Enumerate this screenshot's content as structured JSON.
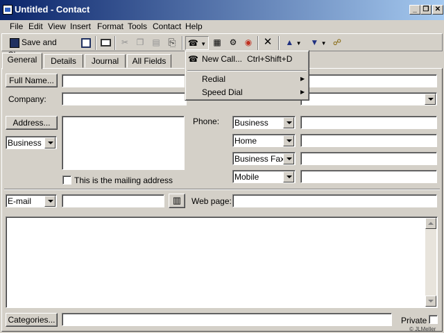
{
  "window": {
    "title": "Untitled - Contact",
    "buttons": {
      "minimize": "_",
      "maximize": "❐",
      "close": "✕"
    }
  },
  "menu": [
    {
      "label": "File",
      "key": "F"
    },
    {
      "label": "Edit",
      "key": "E"
    },
    {
      "label": "View",
      "key": "V"
    },
    {
      "label": "Insert",
      "key": "I"
    },
    {
      "label": "Format",
      "key": "o"
    },
    {
      "label": "Tools",
      "key": "T"
    },
    {
      "label": "Contact",
      "key": "C"
    },
    {
      "label": "Help",
      "key": "H"
    }
  ],
  "toolbar": {
    "save_close": "Save and Close",
    "icons": [
      "save-icon",
      "print-icon",
      "cut-icon",
      "copy-icon",
      "paste-icon",
      "attach-icon",
      "dial-phone-icon",
      "new-meeting-icon",
      "new-task-icon",
      "journal-icon",
      "delete-icon",
      "previous-item-icon",
      "next-item-icon",
      "address-book-icon"
    ]
  },
  "tabs": [
    "General",
    "Details",
    "Journal",
    "All Fields"
  ],
  "form": {
    "full_name_btn": "Full Name...",
    "company_label": "Company:",
    "address_btn": "Address...",
    "address_type": "Business",
    "mailing_label": "This is the mailing address",
    "phone_label": "Phone:",
    "phones": [
      "Business",
      "Home",
      "Business Fax",
      "Mobile"
    ],
    "email_type": "E-mail",
    "webpage_label": "Web page:",
    "categories_btn": "Categories...",
    "private_label": "Private"
  },
  "dial_menu": {
    "new_call": "New Call...",
    "new_call_shortcut": "Ctrl+Shift+D",
    "redial": "Redial",
    "speed_dial": "Speed Dial"
  },
  "watermark": "© JLMeller"
}
